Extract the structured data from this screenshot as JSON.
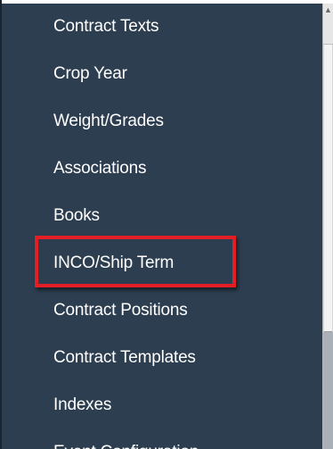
{
  "menu": {
    "items": [
      {
        "label": "Contract Texts"
      },
      {
        "label": "Crop Year"
      },
      {
        "label": "Weight/Grades"
      },
      {
        "label": "Associations"
      },
      {
        "label": "Books"
      },
      {
        "label": "INCO/Ship Term"
      },
      {
        "label": "Contract Positions"
      },
      {
        "label": "Contract Templates"
      },
      {
        "label": "Indexes"
      },
      {
        "label": "Event Configuration"
      }
    ],
    "highlighted_index": 5
  },
  "colors": {
    "panel_background": "#2d3e50",
    "menu_text": "#ffffff",
    "highlight_border": "#e31e24",
    "scrollbar_track": "#d6d6d6"
  },
  "scrollbar": {
    "up_arrow_icon": "scroll-up-arrow-icon"
  }
}
